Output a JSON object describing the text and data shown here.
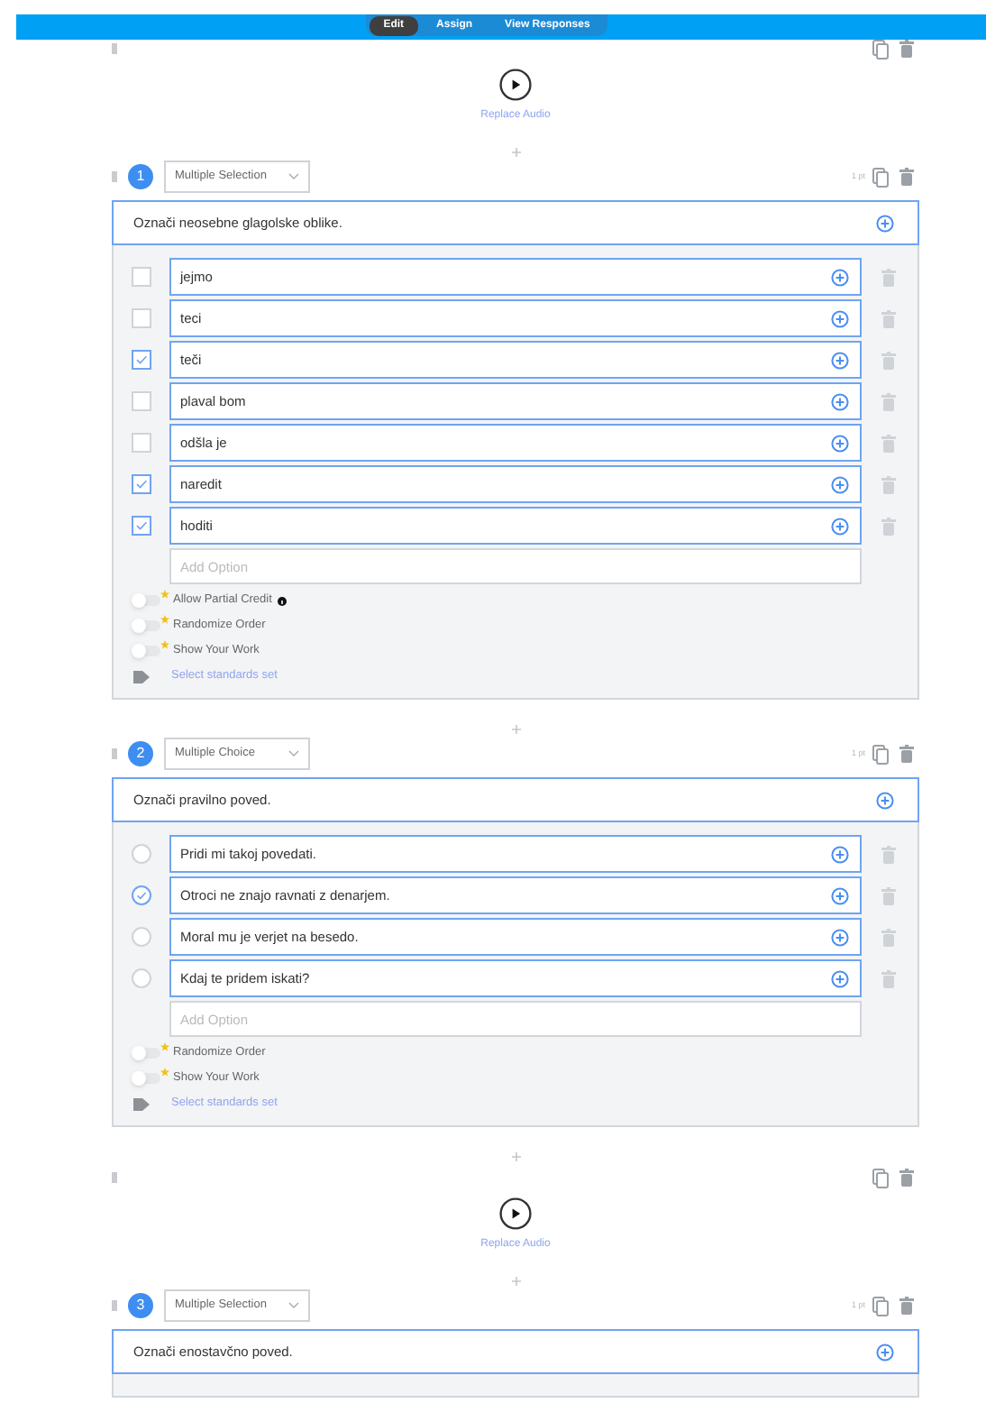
{
  "tabs": [
    {
      "label": "Edit",
      "selected": true
    },
    {
      "label": "Assign",
      "selected": false
    },
    {
      "label": "View Responses",
      "selected": false
    }
  ],
  "blocks": [
    {
      "kind": "audio",
      "link": "Replace Audio"
    },
    {
      "kind": "question",
      "number": "1",
      "type": "Multiple Selection",
      "points": "1 pt",
      "prompt": "Označi neosebne glagolske oblike.",
      "options": [
        {
          "kind": "checkbox",
          "text": "jejmo",
          "selected": false
        },
        {
          "kind": "checkbox",
          "text": "teci",
          "selected": false
        },
        {
          "kind": "checkbox",
          "text": "teči",
          "selected": true
        },
        {
          "kind": "checkbox",
          "text": "plaval bom",
          "selected": false
        },
        {
          "kind": "checkbox",
          "text": "odšla je",
          "selected": false
        },
        {
          "kind": "checkbox",
          "text": "naredit",
          "selected": true
        },
        {
          "kind": "checkbox",
          "text": "hoditi",
          "selected": true
        }
      ],
      "add_option_placeholder": "Add Option",
      "settings": [
        {
          "label": "Allow Partial Credit",
          "on": false,
          "info": true
        },
        {
          "label": "Randomize Order",
          "on": false,
          "info": false
        },
        {
          "label": "Show Your Work",
          "on": false,
          "info": false
        }
      ],
      "standards_link": "Select standards set"
    },
    {
      "kind": "question",
      "number": "2",
      "type": "Multiple Choice",
      "points": "1 pt",
      "prompt": "Označi pravilno poved.",
      "options": [
        {
          "kind": "radio",
          "text": "Pridi mi takoj povedati.",
          "selected": false
        },
        {
          "kind": "radio",
          "text": "Otroci ne znajo ravnati z denarjem.",
          "selected": true
        },
        {
          "kind": "radio",
          "text": "Moral mu je verjet na besedo.",
          "selected": false
        },
        {
          "kind": "radio",
          "text": "Kdaj te pridem iskati?",
          "selected": false
        }
      ],
      "add_option_placeholder": "Add Option",
      "settings": [
        {
          "label": "Randomize Order",
          "on": false,
          "info": false
        },
        {
          "label": "Show Your Work",
          "on": false,
          "info": false
        }
      ],
      "standards_link": "Select standards set"
    },
    {
      "kind": "audio",
      "link": "Replace Audio"
    },
    {
      "kind": "question",
      "number": "3",
      "type": "Multiple Selection",
      "points": "1 pt",
      "prompt": "Označi enostavčno poved."
    }
  ]
}
